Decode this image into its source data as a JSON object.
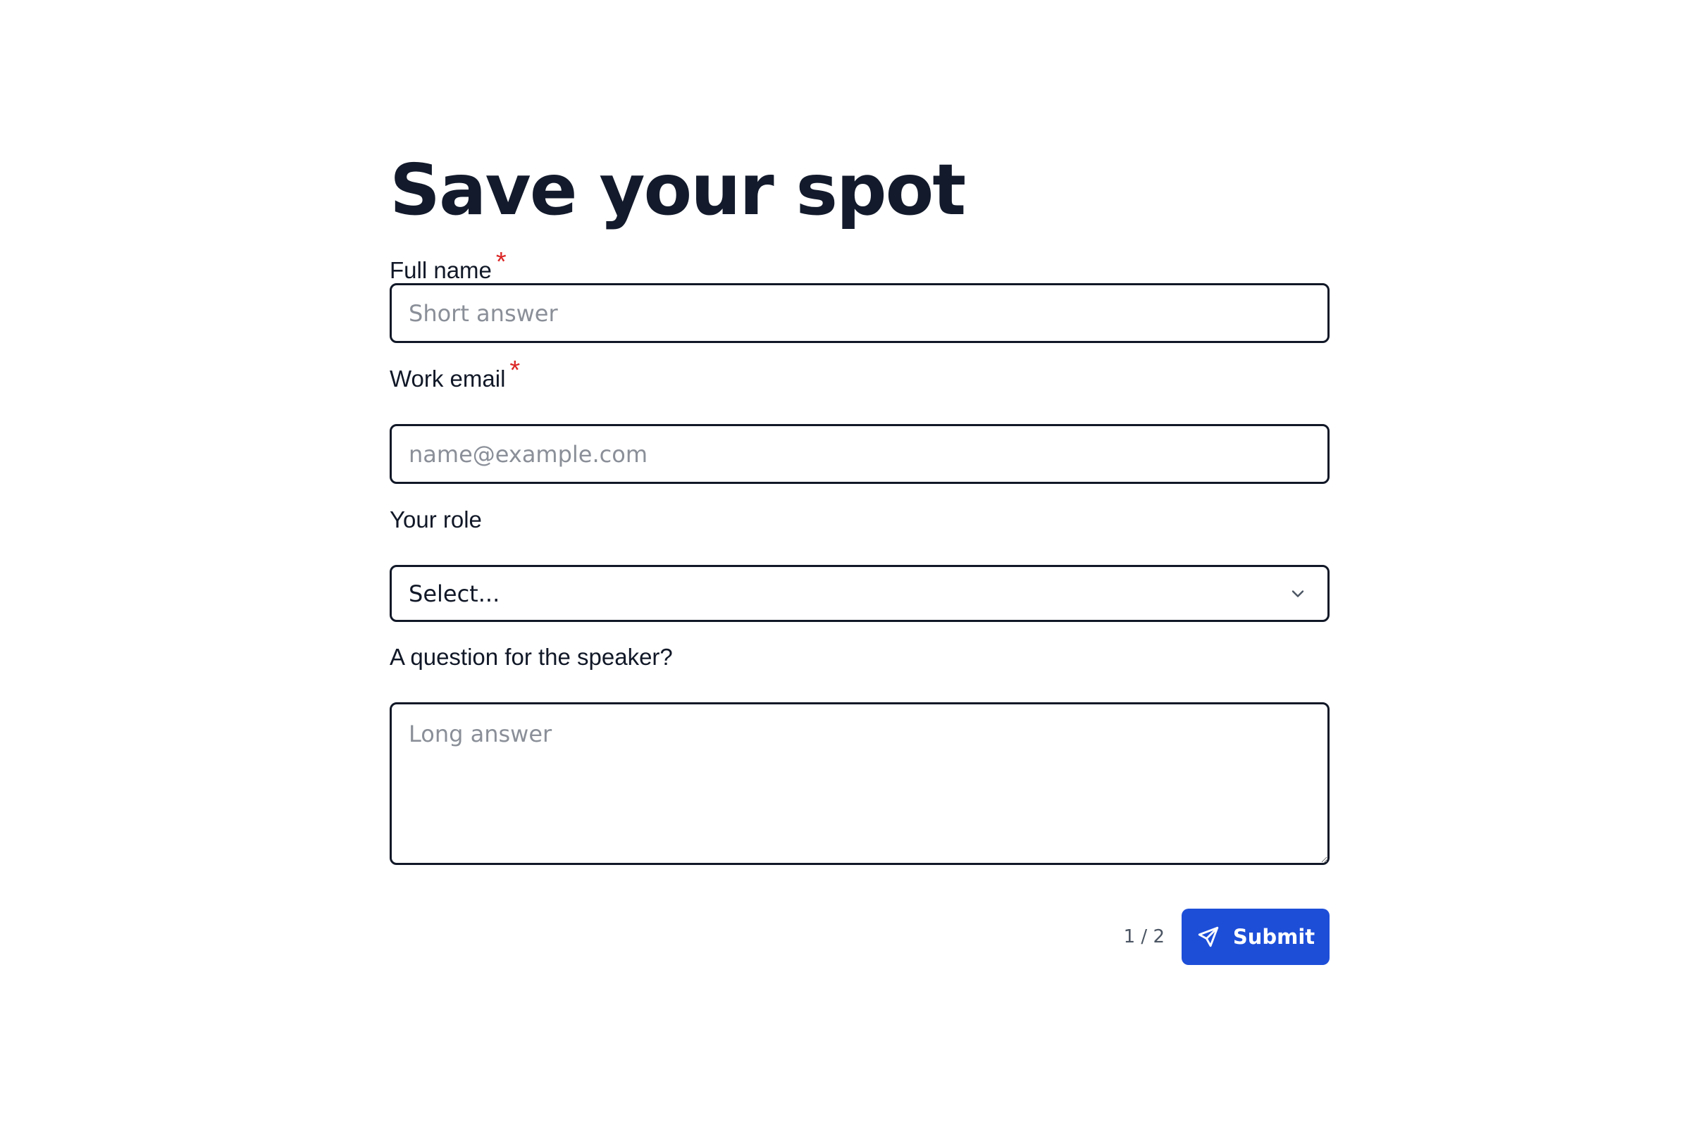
{
  "form": {
    "title": "Save your spot",
    "fields": {
      "full_name": {
        "label": "Full name",
        "required_mark": "*",
        "placeholder": "Short answer",
        "value": ""
      },
      "work_email": {
        "label": "Work email",
        "required_mark": "*",
        "placeholder": "name@example.com",
        "value": ""
      },
      "role": {
        "label": "Your role",
        "selected": "Select..."
      },
      "question": {
        "label": "A question for the speaker?",
        "placeholder": "Long answer",
        "value": ""
      }
    },
    "footer": {
      "page_count": "1 / 2",
      "submit_label": "Submit"
    }
  },
  "colors": {
    "text": "#111827",
    "required": "#dc2626",
    "primary": "#1d4ed8",
    "placeholder": "#8a8f98"
  },
  "icons": {
    "select": "chevron-down-icon",
    "submit": "send-icon"
  }
}
